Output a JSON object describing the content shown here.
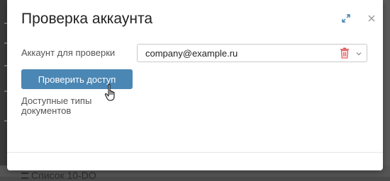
{
  "dialog": {
    "title": "Проверка аккаунта",
    "account_label": "Аккаунт для проверки",
    "account_value": "company@example.ru",
    "check_button_label": "Проверить доступ",
    "docs_label": "Доступные типы документов"
  },
  "background": {
    "bottom_item_label": "Список 10-DO"
  },
  "colors": {
    "accent": "#4b87b4",
    "danger": "#e05a5a",
    "overlay": "#4a4a4a"
  }
}
